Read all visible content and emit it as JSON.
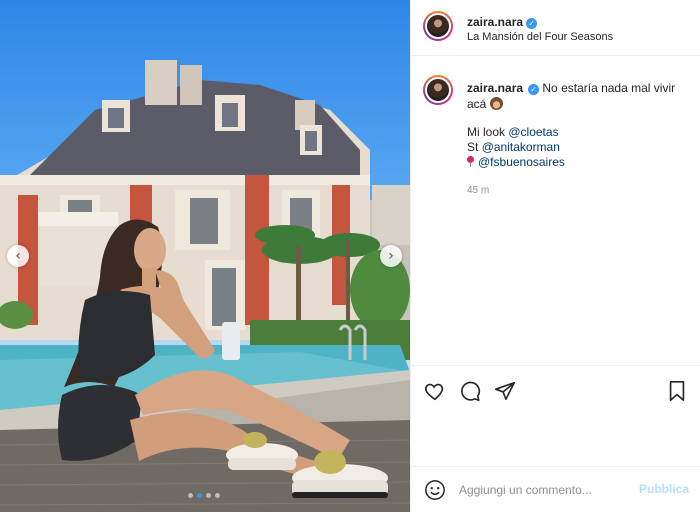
{
  "header": {
    "username": "zaira.nara",
    "location": "La Mansión del Four Seasons"
  },
  "caption": {
    "username": "zaira.nara",
    "text": "No estaría nada mal vivir acá",
    "look_prefix": "Mi look",
    "look_mention": "@cloetas",
    "st_prefix": "St",
    "st_mention": "@anitakorman",
    "location_mention": "@fsbuenosaires",
    "timestamp": "45 m"
  },
  "comment": {
    "placeholder": "Aggiungi un commento...",
    "publish_label": "Pubblica"
  },
  "carousel": {
    "prev_label": "‹",
    "next_label": "›",
    "slide_count": 4,
    "active_slide": 2
  },
  "icons": {
    "verified": "verified-badge-icon",
    "like": "heart-icon",
    "comment": "comment-icon",
    "share": "share-icon",
    "save": "bookmark-icon",
    "emoji": "emoji-icon",
    "location": "pin-icon"
  },
  "colors": {
    "link": "#00376b",
    "verified": "#3897f0",
    "publish_disabled": "#b2dffc",
    "muted": "#8e8e8e"
  }
}
